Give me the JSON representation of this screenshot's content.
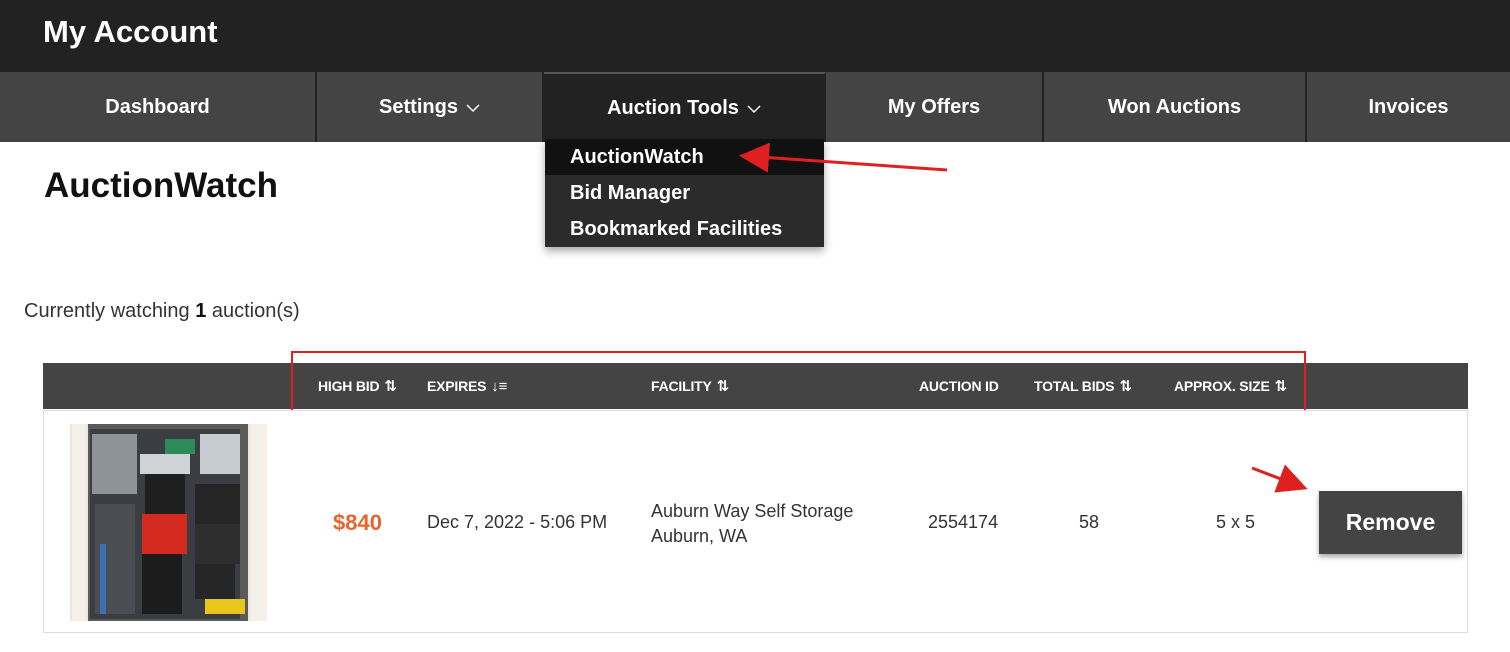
{
  "header": {
    "title": "My Account"
  },
  "nav": {
    "items": [
      {
        "label": "Dashboard"
      },
      {
        "label": "Settings"
      },
      {
        "label": "Auction Tools"
      },
      {
        "label": "My Offers"
      },
      {
        "label": "Won Auctions"
      },
      {
        "label": "Invoices"
      }
    ]
  },
  "dropdown": {
    "items": [
      {
        "label": "AuctionWatch"
      },
      {
        "label": "Bid Manager"
      },
      {
        "label": "Bookmarked Facilities"
      }
    ]
  },
  "page": {
    "title": "AuctionWatch",
    "watch_prefix": "Currently watching",
    "watch_count": "1",
    "watch_suffix": "auction(s)"
  },
  "table": {
    "headers": {
      "high_bid": "HIGH BID",
      "expires": "EXPIRES",
      "facility": "FACILITY",
      "auction_id": "AUCTION ID",
      "total_bids": "TOTAL BIDS",
      "approx_size": "APPROX. SIZE"
    },
    "rows": [
      {
        "high_bid": "$840",
        "expires": "Dec 7, 2022 - 5:06 PM",
        "facility_name": "Auburn Way Self Storage",
        "facility_location": "Auburn, WA",
        "auction_id": "2554174",
        "total_bids": "58",
        "approx_size": "5 x 5",
        "remove_label": "Remove"
      }
    ]
  },
  "colors": {
    "topbar": "#222222",
    "nav": "#444444",
    "bid": "#e8642c",
    "annotation": "#e02020"
  }
}
